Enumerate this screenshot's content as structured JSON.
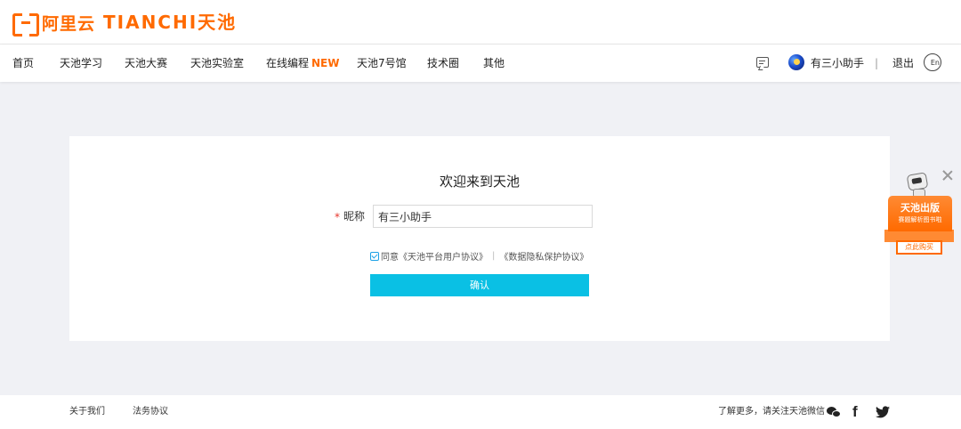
{
  "header": {
    "aliyun_logo": "阿里云",
    "tianchi_logo": "TIANCHI天池"
  },
  "nav": {
    "items": [
      {
        "label": "首页"
      },
      {
        "label": "天池学习"
      },
      {
        "label": "天池大赛"
      },
      {
        "label": "天池实验室"
      },
      {
        "label": "在线编程",
        "badge": "NEW"
      },
      {
        "label": "天池7号馆"
      },
      {
        "label": "技术圈"
      },
      {
        "label": "其他"
      }
    ],
    "user_name": "有三小助手",
    "separator": "|",
    "logout": "退出",
    "lang": "En",
    "icons": [
      "message-icon",
      "avatar",
      "language-icon"
    ]
  },
  "card": {
    "title": "欢迎来到天池",
    "required_mark": "*",
    "nickname_label": "昵称",
    "nickname_value": "有三小助手",
    "agree_prefix": "同意",
    "user_agreement": "《天池平台用户协议》",
    "divider": "|",
    "privacy_agreement": "《数据隐私保护协议》",
    "agree_checked": true,
    "confirm_label": "确认"
  },
  "promo": {
    "title": "天池出版",
    "subtitle": "赛题解析图书啦",
    "button": "点此购买"
  },
  "footer": {
    "about": "关于我们",
    "legal": "法务协议",
    "follow_text": "了解更多，请关注天池微信",
    "icons": [
      "wechat-icon",
      "facebook-icon",
      "twitter-icon"
    ]
  },
  "colors": {
    "brand": "#ff6a00",
    "confirm_button": "#0ac0e4",
    "page_bg": "#f0f1f5"
  }
}
